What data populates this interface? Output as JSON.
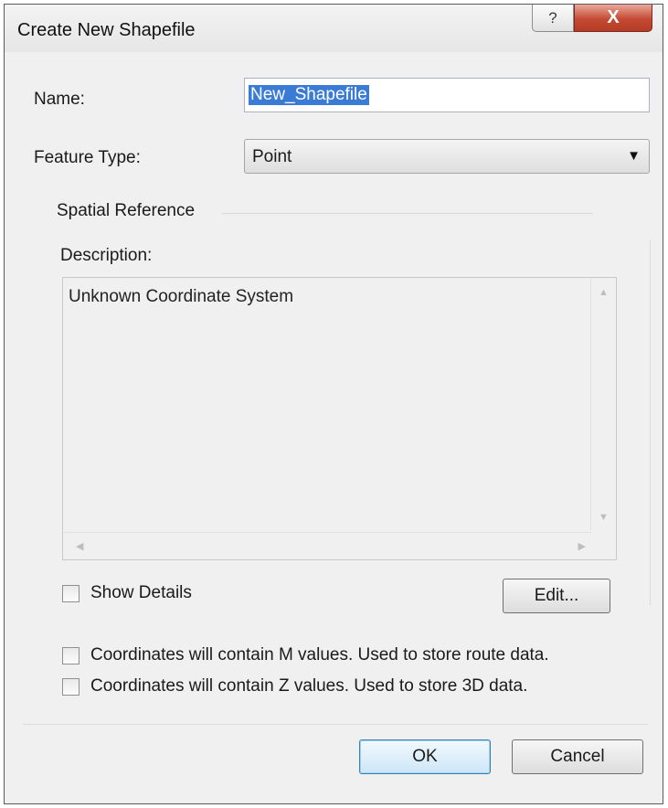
{
  "window": {
    "title": "Create New Shapefile",
    "help_glyph": "?",
    "close_glyph": "X"
  },
  "form": {
    "name_label": "Name:",
    "name_value": "New_Shapefile",
    "feature_type_label": "Feature Type:",
    "feature_type_value": "Point",
    "dropdown_arrow": "▼"
  },
  "spatial_reference": {
    "group_label": "Spatial Reference",
    "description_label": "Description:",
    "description_text": "Unknown Coordinate System",
    "show_details_label": "Show Details",
    "edit_button": "Edit..."
  },
  "options": {
    "m_values_label": "Coordinates will contain M values. Used to store route data.",
    "z_values_label": "Coordinates will contain Z values. Used to store 3D data."
  },
  "buttons": {
    "ok": "OK",
    "cancel": "Cancel"
  },
  "icons": {
    "help": "help-icon",
    "close": "close-icon",
    "dropdown": "chevron-down-icon"
  },
  "colors": {
    "selection": "#3a7bd5",
    "close_button": "#c44a33",
    "dialog_background": "#f0f0f0"
  }
}
